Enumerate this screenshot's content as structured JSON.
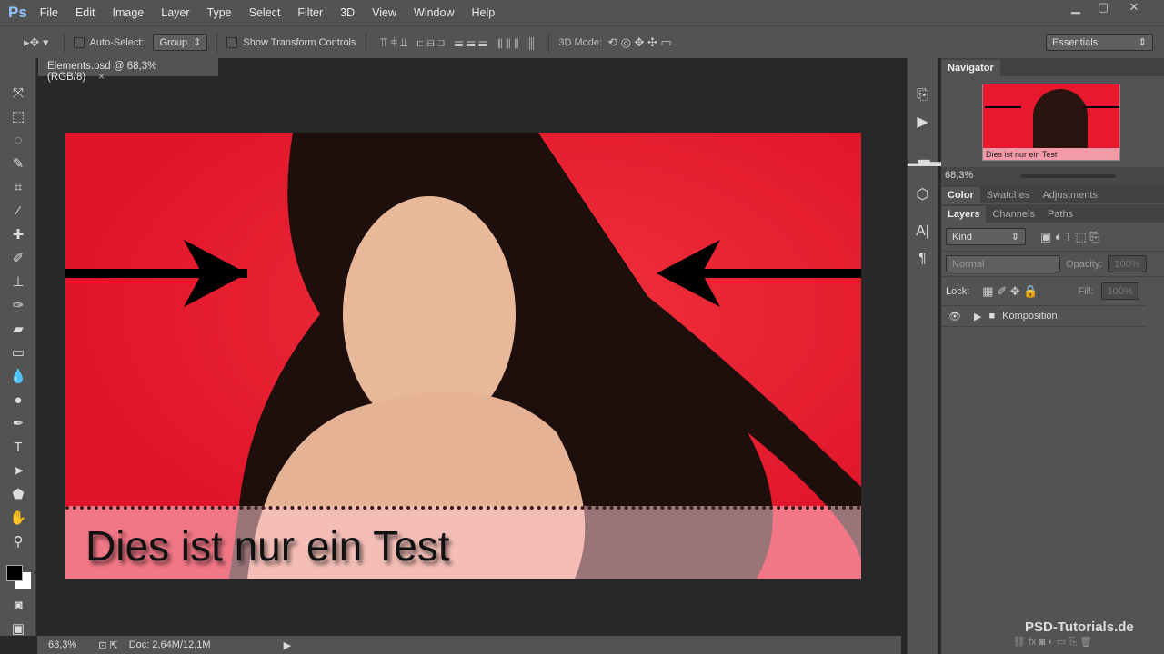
{
  "app": {
    "logo": "Ps"
  },
  "menu": [
    "File",
    "Edit",
    "Image",
    "Layer",
    "Type",
    "Select",
    "Filter",
    "3D",
    "View",
    "Window",
    "Help"
  ],
  "options": {
    "auto_select": "Auto-Select:",
    "group": "Group",
    "show_transform": "Show Transform Controls",
    "mode3d": "3D Mode:",
    "workspace": "Essentials"
  },
  "document": {
    "tab": "Elements.psd @ 68,3% (RGB/8)",
    "close": "×",
    "banner_text": "Dies ist nur ein Test"
  },
  "status": {
    "zoom": "68,3%",
    "doc": "Doc: 2,64M/12,1M"
  },
  "navigator": {
    "title": "Navigator",
    "zoom": "68,3%",
    "thumb_text": "Dies ist nur ein Test"
  },
  "color_tabs": [
    "Color",
    "Swatches",
    "Adjustments"
  ],
  "layers_tabs": [
    "Layers",
    "Channels",
    "Paths"
  ],
  "layers": {
    "filter": "Kind",
    "blend": "Normal",
    "opacity_label": "Opacity:",
    "opacity": "100%",
    "lock_label": "Lock:",
    "fill_label": "Fill:",
    "fill": "100%",
    "items": [
      {
        "name": "Komposition"
      }
    ]
  },
  "watermark": "PSD-Tutorials.de"
}
